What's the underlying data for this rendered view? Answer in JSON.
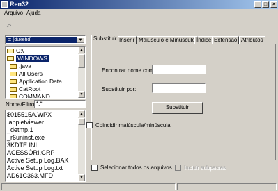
{
  "window": {
    "title": "Ren32"
  },
  "menu": {
    "items": [
      "Arquivo",
      "Ajuda"
    ]
  },
  "drive": {
    "selected": "c: [dukehd]"
  },
  "directories": [
    {
      "name": "C:\\",
      "type": "root"
    },
    {
      "name": "WINDOWS",
      "type": "open",
      "selected": true
    },
    {
      "name": ".java",
      "type": "folder"
    },
    {
      "name": "All Users",
      "type": "folder"
    },
    {
      "name": "Application Data",
      "type": "folder"
    },
    {
      "name": "CatRoot",
      "type": "folder"
    },
    {
      "name": "COMMAND",
      "type": "folder"
    }
  ],
  "filter": {
    "label": "Nome/Filtro:",
    "value": "*.*"
  },
  "files": [
    "$015515A.WPX",
    ".appletviewer",
    "_detmp.1",
    "_r6uninst.exe",
    "3KDTE.INI",
    "ACESSÓRI.GRP",
    "Active Setup Log.BAK",
    "Active Setup Log.txt",
    "AD61C363.MFD"
  ],
  "tabs": [
    "Substituir",
    "Inserir",
    "Maiúsculo e Minúsculo",
    "Índice",
    "Extensão",
    "Atributos"
  ],
  "form": {
    "find_label": "Encontrar nome com:",
    "find_value": "",
    "replace_label": "Substituir por:",
    "replace_value": "",
    "replace_button": "Substituir",
    "case_checkbox": "Coincidir maiúscula/minúscula"
  },
  "options": {
    "select_all": "Selecionar todos os arquivos",
    "include_subfolders": "Incluir subpastas"
  }
}
